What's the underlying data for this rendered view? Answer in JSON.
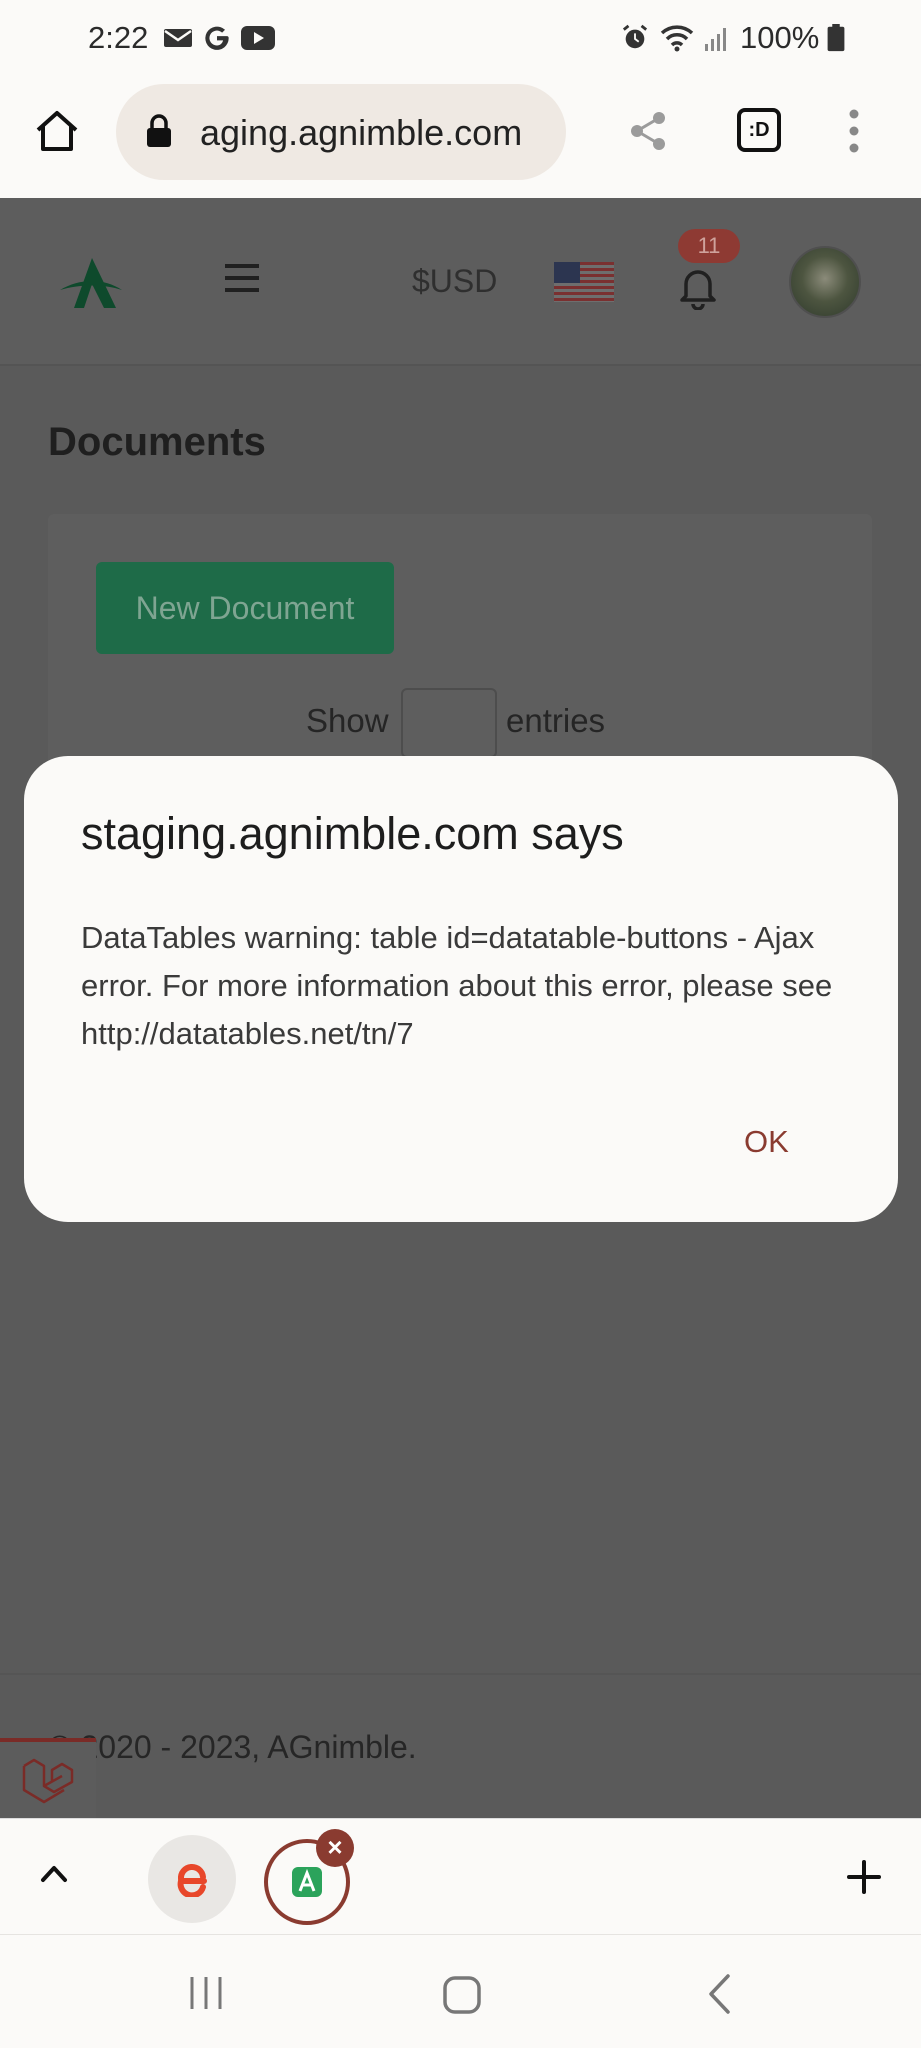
{
  "status_bar": {
    "time": "2:22",
    "battery_text": "100%",
    "icons": [
      "mail-icon",
      "google-icon",
      "youtube-icon",
      "alarm-icon",
      "wifi-icon",
      "signal-icon",
      "battery-icon"
    ]
  },
  "browser": {
    "url": "aging.agnimble.com",
    "tab_count_label": ":D"
  },
  "site_header": {
    "currency": "$USD",
    "notification_count": "11"
  },
  "page": {
    "title": "Documents",
    "new_document_label": "New Document",
    "show_label": "Show",
    "entries_value": "",
    "entries_label": "entries",
    "footer": "© 2020 - 2023, AGnimble."
  },
  "dialog": {
    "title": "staging.agnimble.com says",
    "message": "DataTables warning: table id=datatable-buttons - Ajax error. For more information about this error, please see http://datatables.net/tn/7",
    "ok_label": "OK"
  },
  "tab_strip": {
    "tabs": [
      {
        "icon": "e-favicon"
      },
      {
        "icon": "a-favicon",
        "active": true
      }
    ]
  },
  "colors": {
    "accent": "#8a3b30",
    "brand_green": "#1e6b48",
    "scrim": "#5a5a5a"
  }
}
